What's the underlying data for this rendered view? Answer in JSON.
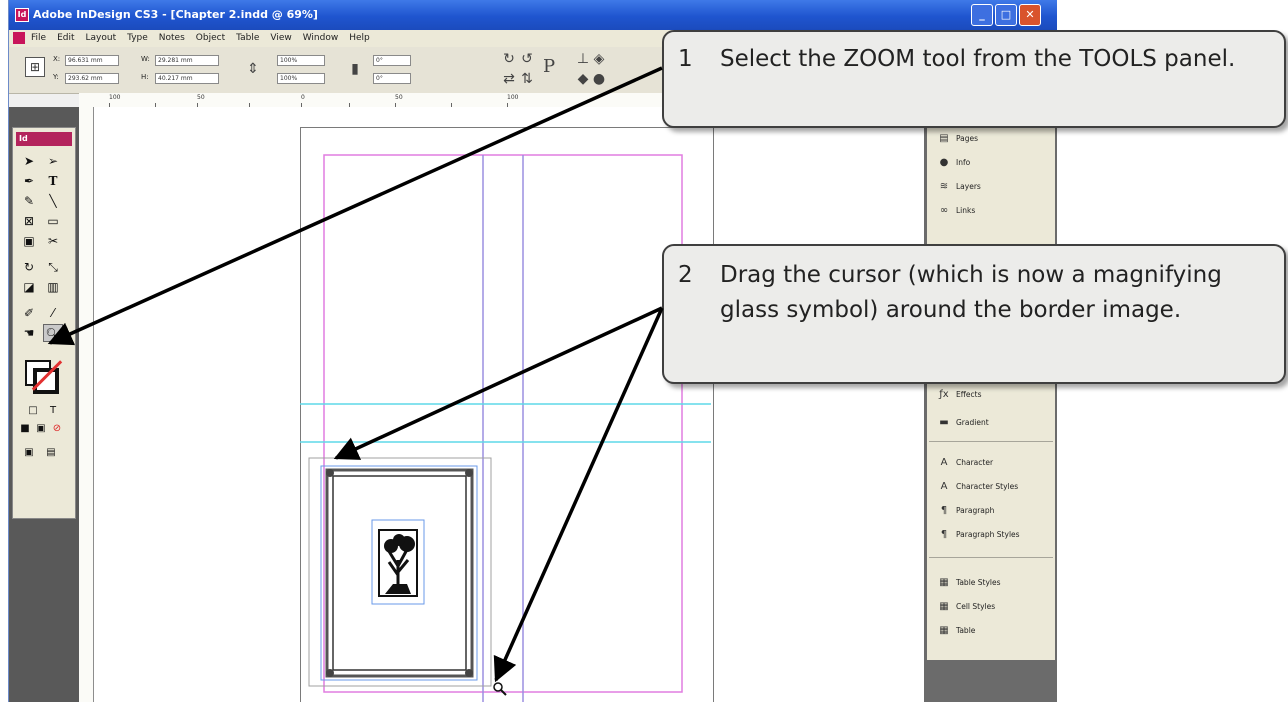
{
  "window": {
    "title": "Adobe InDesign CS3 - [Chapter 2.indd @ 69%]",
    "app_icon_label": "Id",
    "buttons": {
      "minimize": "_",
      "maximize": "□",
      "close": "✕"
    }
  },
  "menubar": {
    "items": [
      "File",
      "Edit",
      "Layout",
      "Type",
      "Notes",
      "Object",
      "Table",
      "View",
      "Window",
      "Help"
    ]
  },
  "control": {
    "x_label": "X:",
    "x_value": "96.631 mm",
    "y_label": "Y:",
    "y_value": "293.62 mm",
    "w_label": "W:",
    "w_value": "29.281 mm",
    "h_label": "H:",
    "h_value": "40.217 mm",
    "scale_x": "100%",
    "scale_y": "100%",
    "rotate": "0°",
    "shear": "0°"
  },
  "ruler": {
    "labels": [
      "100",
      "50",
      "0",
      "50",
      "100"
    ]
  },
  "tools": {
    "title": "Id"
  },
  "dock": {
    "items": [
      {
        "label": "Pages",
        "icon": "pages-icon",
        "glyph": "▤"
      },
      {
        "label": "Info",
        "icon": "info-icon",
        "glyph": "●"
      },
      {
        "label": "Layers",
        "icon": "layers-icon",
        "glyph": "≋"
      },
      {
        "label": "Links",
        "icon": "links-icon",
        "glyph": "∞"
      },
      {
        "label": "Effects",
        "icon": "effects-icon",
        "glyph": "ƒx"
      },
      {
        "label": "Gradient",
        "icon": "gradient-icon",
        "glyph": "▬"
      },
      {
        "label": "Character",
        "icon": "character-icon",
        "glyph": "A"
      },
      {
        "label": "Character Styles",
        "icon": "character-styles-icon",
        "glyph": "A"
      },
      {
        "label": "Paragraph",
        "icon": "paragraph-icon",
        "glyph": "¶"
      },
      {
        "label": "Paragraph Styles",
        "icon": "paragraph-styles-icon",
        "glyph": "¶"
      },
      {
        "label": "Table Styles",
        "icon": "table-styles-icon",
        "glyph": "▦"
      },
      {
        "label": "Cell Styles",
        "icon": "cell-styles-icon",
        "glyph": "▦"
      },
      {
        "label": "Table",
        "icon": "table-icon",
        "glyph": "▦"
      }
    ]
  },
  "callouts": [
    {
      "num": "1",
      "text": "Select the ZOOM tool from the TOOLS panel."
    },
    {
      "num": "2",
      "text": "Drag the cursor (which is now a magnifying glass symbol) around the border image."
    }
  ],
  "colors": {
    "title_bar": "#1f55cf",
    "margin_guide": "#e17de0",
    "column_guide": "#9b8fe0",
    "horizontal_guide": "#5fd8e8",
    "frame_selection": "#6a9ae8",
    "arrow": "#000000"
  }
}
